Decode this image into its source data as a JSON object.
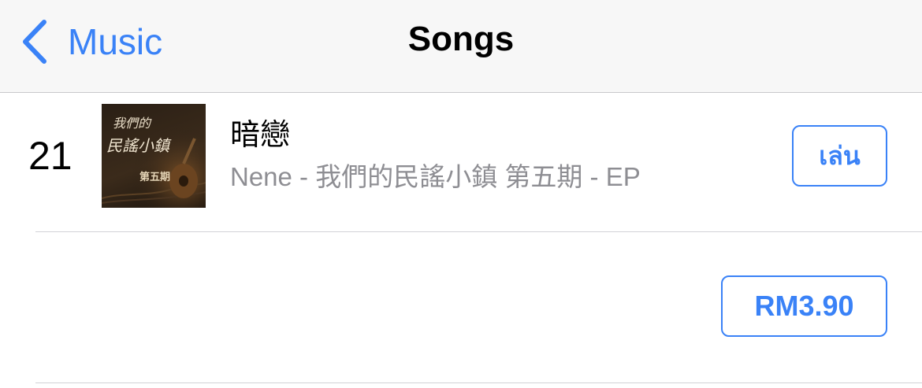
{
  "navbar": {
    "back_label": "Music",
    "title": "Songs"
  },
  "songs": [
    {
      "rank": "21",
      "title": "暗戀",
      "subtitle": "Nene - 我們的民謠小鎮 第五期 - EP",
      "artwork_text": {
        "line1": "我們的",
        "line2": "民謠小鎮",
        "badge": "第五期"
      },
      "action_label": "เล่น"
    },
    {
      "rank": "",
      "title": "",
      "subtitle": "",
      "action_label": "RM3.90"
    }
  ],
  "colors": {
    "accent": "#3a82f7",
    "secondary_text": "#8e8e93",
    "navbar_bg": "#f7f7f7",
    "divider": "#d1d1d6"
  },
  "icons": {
    "back": "chevron-left-icon"
  }
}
